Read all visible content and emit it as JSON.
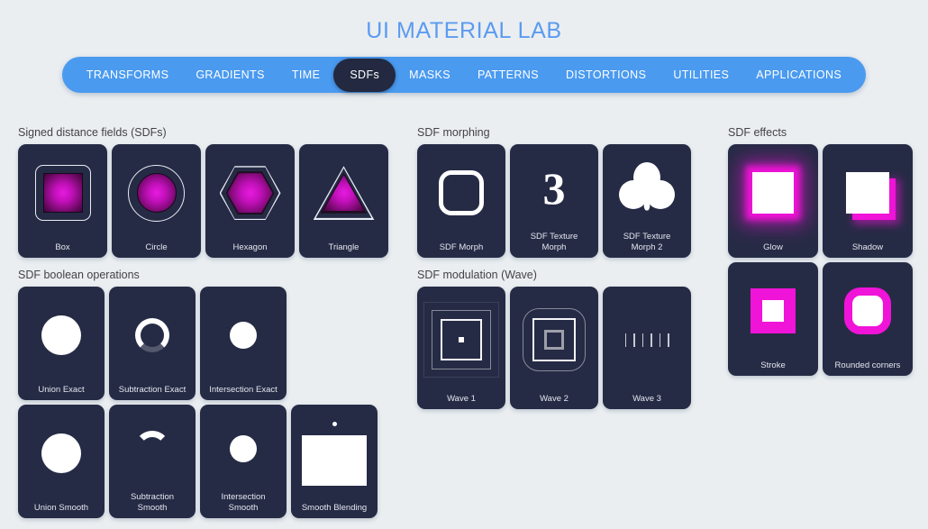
{
  "header": {
    "title": "UI MATERIAL LAB",
    "title_color": "#5b9bf0"
  },
  "nav": {
    "active": "SDFs",
    "bar_color": "#4a9af0",
    "active_color": "#232940",
    "tabs": [
      {
        "label": "TRANSFORMS"
      },
      {
        "label": "GRADIENTS"
      },
      {
        "label": "TIME"
      },
      {
        "label": "SDFs"
      },
      {
        "label": "MASKS"
      },
      {
        "label": "PATTERNS"
      },
      {
        "label": "DISTORTIONS"
      },
      {
        "label": "UTILITIES"
      },
      {
        "label": "APPLICATIONS"
      }
    ]
  },
  "theme": {
    "page_bg": "#eaeef1",
    "card_bg": "#262b45",
    "accent_magenta": "#f013d8",
    "shape_magenta": "#c010b8",
    "label_color": "#e3e6ef",
    "section_color": "#434343"
  },
  "sections": {
    "sdf_primitives": {
      "title": "Signed distance fields (SDFs)",
      "cards": [
        {
          "label": "Box"
        },
        {
          "label": "Circle"
        },
        {
          "label": "Hexagon"
        },
        {
          "label": "Triangle"
        }
      ]
    },
    "boolean_ops": {
      "title": "SDF boolean operations",
      "row1": [
        {
          "label": "Union Exact"
        },
        {
          "label": "Subtraction Exact"
        },
        {
          "label": "Intersection Exact"
        }
      ],
      "row2": [
        {
          "label": "Union Smooth"
        },
        {
          "label": "Subtraction\nSmooth"
        },
        {
          "label": "Intersection\nSmooth"
        },
        {
          "label": "Smooth Blending"
        }
      ]
    },
    "morphing": {
      "title": "SDF morphing",
      "cards": [
        {
          "label": "SDF Morph"
        },
        {
          "label": "SDF Texture\nMorph"
        },
        {
          "label": "SDF Texture\nMorph 2"
        }
      ]
    },
    "modulation": {
      "title": "SDF modulation (Wave)",
      "cards": [
        {
          "label": "Wave 1"
        },
        {
          "label": "Wave 2"
        },
        {
          "label": "Wave 3"
        }
      ]
    },
    "effects": {
      "title": "SDF effects",
      "cards": [
        {
          "label": "Glow"
        },
        {
          "label": "Shadow"
        },
        {
          "label": "Stroke"
        },
        {
          "label": "Rounded corners"
        }
      ]
    }
  }
}
